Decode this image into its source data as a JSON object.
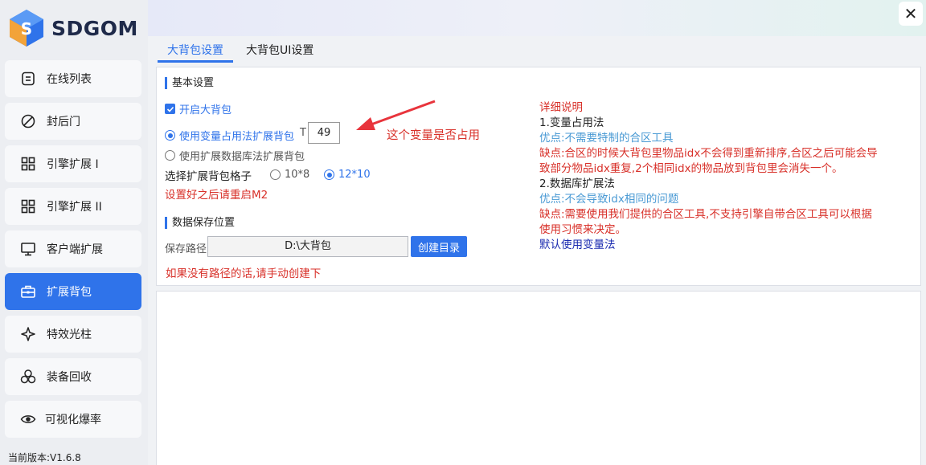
{
  "app": {
    "logo_text": "SDGOM",
    "version": "当前版本:V1.6.8",
    "close_glyph": "✕"
  },
  "sidebar": {
    "items": [
      {
        "label": "在线列表",
        "icon": "list-icon"
      },
      {
        "label": "封后门",
        "icon": "block-icon"
      },
      {
        "label": "引擎扩展 I",
        "icon": "grid-icon"
      },
      {
        "label": "引擎扩展 II",
        "icon": "grid-icon"
      },
      {
        "label": "客户端扩展",
        "icon": "monitor-icon"
      },
      {
        "label": "扩展背包",
        "icon": "briefcase-icon",
        "active": true
      },
      {
        "label": "特效光柱",
        "icon": "sparkle-icon"
      },
      {
        "label": "装备回收",
        "icon": "recycle-icon"
      },
      {
        "label": "可视化爆率",
        "icon": "eye-icon"
      }
    ]
  },
  "tabs": [
    {
      "label": "大背包设置",
      "active": true
    },
    {
      "label": "大背包UI设置",
      "active": false
    }
  ],
  "basic": {
    "title": "基本设置",
    "enable_label": "开启大背包",
    "enable_checked": true,
    "mode_var_label": "使用变量占用法扩展背包",
    "t_prefix": "T",
    "t_value": "49",
    "annotation": "这个变量是否占用",
    "mode_db_label": "使用扩展数据库法扩展背包",
    "grid_label": "选择扩展背包格子",
    "grid_options": [
      "10*8",
      "12*10"
    ],
    "grid_selected": "12*10",
    "restart_note": "设置好之后请重启M2"
  },
  "storage": {
    "title": "数据保存位置",
    "path_label": "保存路径",
    "path_value": "D:\\大背包",
    "create_button": "创建目录",
    "note": "如果没有路径的话,请手动创建下"
  },
  "description": {
    "heading": "详细说明",
    "method1": "1.变量占用法",
    "pro1": "优点:不需要特制的合区工具",
    "con1_line1": "缺点:合区的时候大背包里物品idx不会得到重新排序,合区之后可能会导",
    "con1_line2": "致部分物品idx重复,2个相同idx的物品放到背包里会消失一个。",
    "method2": "2.数据库扩展法",
    "pro2": "优点:不会导致idx相同的问题",
    "con2_line1": "缺点:需要使用我们提供的合区工具,不支持引擎自带合区工具可以根据",
    "con2_line2": "使用习惯来决定。",
    "default": "默认使用变量法"
  },
  "colors": {
    "accent": "#2f73ea",
    "warning": "#d8312a",
    "pro": "#4a9ad4",
    "default_note": "#1b2bb0"
  }
}
